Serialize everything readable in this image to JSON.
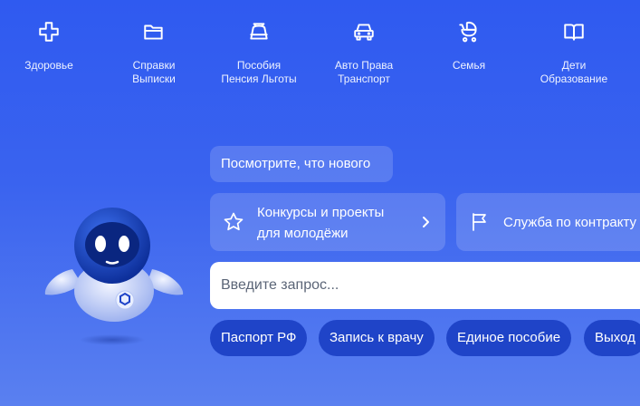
{
  "categories": [
    {
      "icon": "plus-cross-icon",
      "line1": "Здоровье",
      "line2": ""
    },
    {
      "icon": "folder-icon",
      "line1": "Справки",
      "line2": "Выписки"
    },
    {
      "icon": "wallet-bag-icon",
      "line1": "Пособия",
      "line2": "Пенсия Льготы"
    },
    {
      "icon": "car-icon",
      "line1": "Авто Права",
      "line2": "Транспорт"
    },
    {
      "icon": "stroller-icon",
      "line1": "Семья",
      "line2": ""
    },
    {
      "icon": "book-icon",
      "line1": "Дети",
      "line2": "Образование"
    }
  ],
  "news": {
    "label": "Посмотрите, что нового"
  },
  "promos": [
    {
      "icon": "star-icon",
      "line1": "Конкурсы и проекты",
      "line2": "для молодёжи"
    },
    {
      "icon": "flag-icon",
      "line1": "Служба по контракту"
    }
  ],
  "search": {
    "placeholder": "Введите запрос..."
  },
  "chips": [
    {
      "label": "Паспорт РФ"
    },
    {
      "label": "Запись к врачу"
    },
    {
      "label": "Единое пособие"
    },
    {
      "label": "Выход"
    }
  ],
  "colors": {
    "background": "#3a63ef",
    "chip": "#1f44c8",
    "card": "rgba(255,255,255,0.16)"
  }
}
